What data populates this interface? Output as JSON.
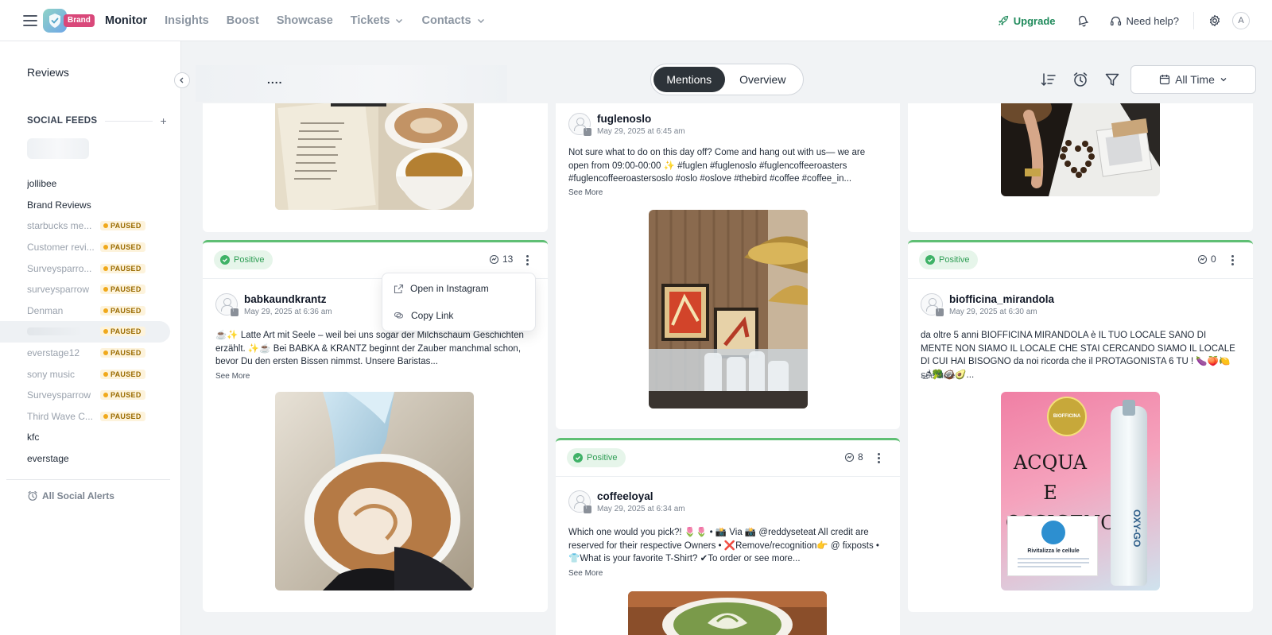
{
  "nav": {
    "brand_badge": "Brand",
    "items": [
      {
        "label": "Monitor",
        "active": true
      },
      {
        "label": "Insights"
      },
      {
        "label": "Boost"
      },
      {
        "label": "Showcase"
      },
      {
        "label": "Tickets",
        "dropdown": true
      },
      {
        "label": "Contacts",
        "dropdown": true
      }
    ],
    "upgrade": "Upgrade",
    "help": "Need help?",
    "avatar": "A"
  },
  "sidebar": {
    "title": "Reviews",
    "feeds_label": "SOCIAL FEEDS",
    "feeds": [
      {
        "name": "jollibee"
      },
      {
        "name": "Brand Reviews"
      },
      {
        "name": "starbucks me...",
        "paused": true
      },
      {
        "name": "Customer revi...",
        "paused": true
      },
      {
        "name": "Surveysparro...",
        "paused": true
      },
      {
        "name": "surveysparrow",
        "paused": true
      },
      {
        "name": "Denman",
        "paused": true
      },
      {
        "name": "",
        "paused": true,
        "selected": true
      },
      {
        "name": "everstage12",
        "paused": true
      },
      {
        "name": "sony music",
        "paused": true
      },
      {
        "name": "Surveysparrow",
        "paused": true
      },
      {
        "name": "Third Wave C...",
        "paused": true
      },
      {
        "name": "kfc"
      },
      {
        "name": "everstage"
      }
    ],
    "paused_label": "PAUSED",
    "alerts": "All Social Alerts"
  },
  "toolbar": {
    "breadcrumb": "....",
    "tabs": [
      "Mentions",
      "Overview"
    ],
    "date_range": "All Time"
  },
  "menu": {
    "items": [
      "Open in Instagram",
      "Copy Link"
    ]
  },
  "colors": {
    "positive": "#5fbf74",
    "accent_green": "#1f8a5b",
    "paused_bg": "#fdf3dc",
    "brand_pink": "#d9487a"
  },
  "cards": {
    "c2": {
      "author": "fuglenoslo",
      "date": "May 29, 2025 at 6:45 am",
      "text": "Not sure what to do on this day off? Come and hang out with us— we are open from 09:00-00:00 ✨ #fuglen #fuglenoslo #fuglencoffeeroasters #fuglencoffeeroastersoslo #oslo #oslove #thebird #coffee #coffee_in...",
      "see_more": "See More"
    },
    "c4": {
      "sentiment": "Positive",
      "engagement": "13",
      "author": "babkaundkrantz",
      "date": "May 29, 2025 at 6:36 am",
      "text": "☕✨ Latte Art mit Seele – weil bei uns sogar der Milchschaum Geschichten erzählt. ✨☕ Bei BABKA & KRANTZ beginnt der Zauber manchmal schon, bevor Du den ersten Bissen nimmst. Unsere Baristas...",
      "see_more": "See More"
    },
    "c5": {
      "sentiment": "Positive",
      "engagement": "8",
      "author": "coffeeloyal",
      "date": "May 29, 2025 at 6:34 am",
      "text": "Which one would you pick?! 🌷🌷 • 📸 Via 📸 @reddyseteat All credit are reserved for their respective Owners • ❌Remove/recognition👉 @ fixposts • 👕What is your favorite T-Shirt? ✔To order or see more...",
      "see_more": "See More"
    },
    "c6": {
      "sentiment": "Positive",
      "engagement": "0",
      "author": "biofficina_mirandola",
      "date": "May 29, 2025 at 6:30 am",
      "text": "da oltre 5 anni BIOFFICINA MIRANDOLA è IL TUO LOCALE SANO DI MENTE NON SIAMO IL LOCALE CHE STAI CERCANDO SIAMO IL LOCALE DI CUI HAI BISOGNO da noi ricorda che il PROTAGONISTA 6 TU ! 🍆🍑🍋🌶🥦🥥🥑...",
      "see_more": "See More",
      "poster": {
        "logo": "BIOFFICINA",
        "headline": "ACQUA E OSSIGENO",
        "bottle": "OXY-GO",
        "caption": "Rivitalizza le cellule"
      }
    }
  }
}
